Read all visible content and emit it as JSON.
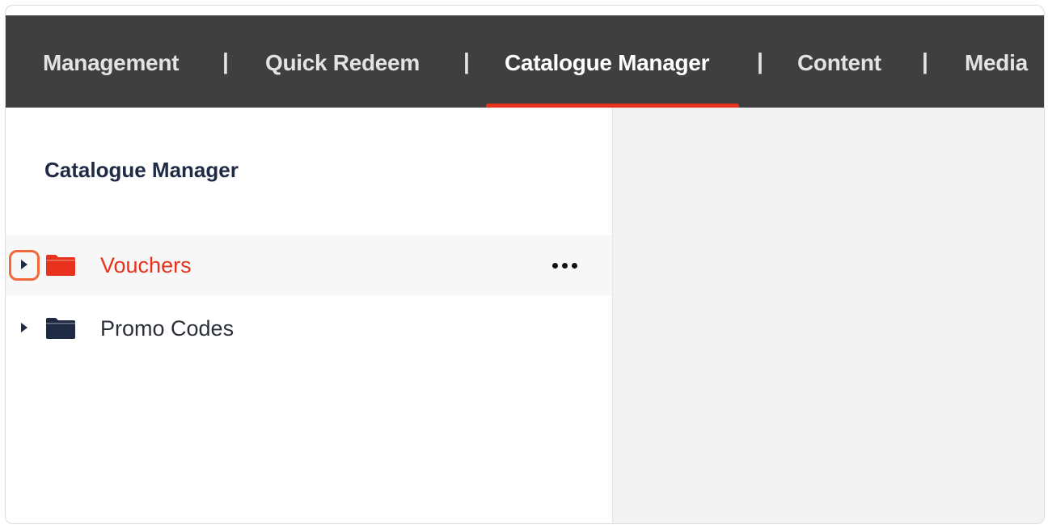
{
  "nav": {
    "items": [
      {
        "label": "Management"
      },
      {
        "label": "Quick Redeem"
      },
      {
        "label": "Catalogue Manager"
      },
      {
        "label": "Content"
      },
      {
        "label": "Media"
      }
    ],
    "separator": "|",
    "active_index": 2,
    "accent_color": "#e8321c"
  },
  "left_pane": {
    "title": "Catalogue Manager",
    "tree": [
      {
        "label": "Vouchers",
        "icon": "folder-icon",
        "color": "#e8321c",
        "selected": true
      },
      {
        "label": "Promo Codes",
        "icon": "folder-icon",
        "color": "#1f2a44",
        "selected": false
      }
    ]
  },
  "icons": {
    "expand": "caret-right-icon",
    "more": "more-horizontal-icon"
  }
}
